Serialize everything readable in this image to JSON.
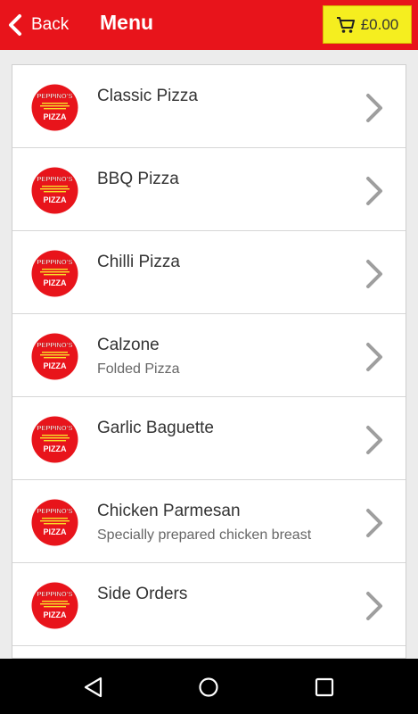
{
  "header": {
    "back_label": "Back",
    "title": "Menu",
    "cart_amount": "£0.00"
  },
  "brand": {
    "logo_line1": "PEPPINO'S",
    "logo_line2": "PIZZA"
  },
  "colors": {
    "header_red": "#e8141b",
    "cart_yellow": "#f5ee1f",
    "chevron_gray": "#9e9e9e"
  },
  "menu": {
    "items": [
      {
        "name": "Classic Pizza",
        "desc": ""
      },
      {
        "name": "BBQ Pizza",
        "desc": ""
      },
      {
        "name": "Chilli Pizza",
        "desc": ""
      },
      {
        "name": "Calzone",
        "desc": "Folded Pizza"
      },
      {
        "name": "Garlic Baguette",
        "desc": ""
      },
      {
        "name": "Chicken Parmesan",
        "desc": "Specially prepared chicken breast"
      },
      {
        "name": "Side Orders",
        "desc": ""
      }
    ]
  },
  "system_nav": {
    "icons": [
      "back-triangle-icon",
      "home-circle-icon",
      "recents-square-icon"
    ]
  }
}
